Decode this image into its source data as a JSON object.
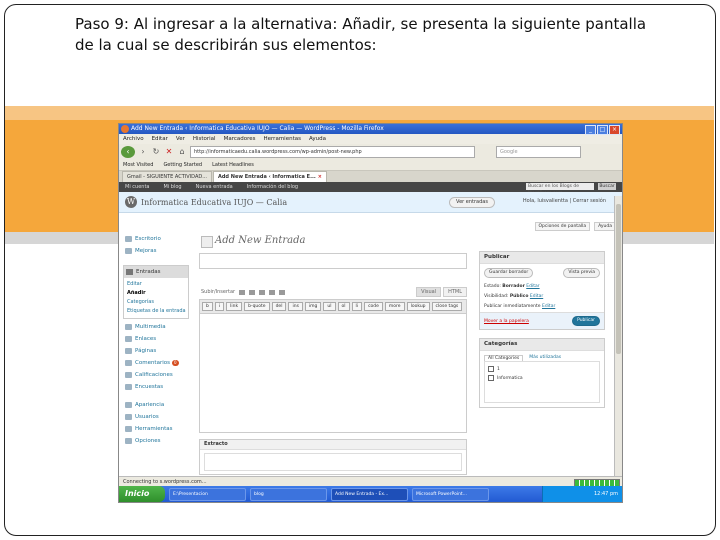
{
  "caption": {
    "line1": "Paso 9: Al ingresar a la alternativa: Añadir, se presenta la siguiente pantalla",
    "line2": "de la cual se describirán sus elementos:"
  },
  "browser": {
    "title": "Add New Entrada ‹ Informatica Educativa IUJO — Calia — WordPress - Mozilla Firefox",
    "menu": [
      "Archivo",
      "Editar",
      "Ver",
      "Historial",
      "Marcadores",
      "Herramientas",
      "Ayuda"
    ],
    "url": "http://informaticaedu.calia.wordpress.com/wp-admin/post-new.php",
    "search_placeholder": "Google",
    "bookmarks": [
      "Most Visited",
      "Getting Started",
      "Latest Headlines"
    ],
    "tabs": [
      {
        "label": "Gmail - SIGUIENTE ACTIVIDAD...",
        "active": false
      },
      {
        "label": "Add New Entrada ‹ Informatica E...",
        "active": true
      }
    ]
  },
  "wp_adminbar": {
    "items": [
      "Mi cuenta",
      "Mi blog",
      "Nueva entrada",
      "Información del blog"
    ],
    "search_placeholder": "Buscar en los Blogs de WordPress.com",
    "search_button": "Buscar"
  },
  "wp_header": {
    "blog_title": "Informatica Educativa IUJO — Calia",
    "new_post": "Ver entradas",
    "user_links": "Hola, luisvalientta | Cerrar sesión"
  },
  "screen_options": [
    "Opciones de pantalla",
    "Ayuda"
  ],
  "sidebar": {
    "top_items": [
      "Escritorio",
      "Mejoras"
    ],
    "open_menu": "Entradas",
    "submenu": [
      "Editar",
      "Añadir",
      "Categorías",
      "Etiquetas de la entrada"
    ],
    "submenu_current": "Añadir",
    "items": [
      "Multimedia",
      "Enlaces",
      "Páginas",
      "Comentarios",
      "Calificaciones",
      "Encuestas"
    ],
    "comments_badge": "0",
    "bottom_items": [
      "Apariencia",
      "Usuarios",
      "Herramientas",
      "Opciones"
    ]
  },
  "editor": {
    "page_title": "Add New Entrada",
    "upload_label": "Subir/Insertar",
    "tabs": [
      "Visual",
      "HTML"
    ],
    "quicktags": [
      "b",
      "i",
      "link",
      "b-quote",
      "del",
      "ins",
      "img",
      "ul",
      "ol",
      "li",
      "code",
      "more",
      "lookup",
      "close tags"
    ],
    "excerpt_label": "Extracto"
  },
  "publish_box": {
    "title": "Publicar",
    "save_draft": "Guardar borrador",
    "preview": "Vista previa",
    "status_label": "Estado:",
    "status_value": "Borrador",
    "status_edit": "Editar",
    "visibility_label": "Visibilidad:",
    "visibility_value": "Público",
    "visibility_edit": "Editar",
    "publish_time": "Publicar inmediatamente",
    "publish_time_edit": "Editar",
    "trash": "Mover a la papelera",
    "publish": "Publicar"
  },
  "categories_box": {
    "title": "Categorías",
    "tab_all": "All Categories",
    "tab_popular": "Más utilizadas",
    "items": [
      "1",
      "Informatica"
    ]
  },
  "status_bar": {
    "text": "Connecting to s.wordpress.com..."
  },
  "taskbar": {
    "start": "Inicio",
    "tasks": [
      "E:\\Presentacion",
      "blog",
      "Add New Entrada - Ex...",
      "Microsoft PowerPoint..."
    ],
    "active_task": 2,
    "clock": "12:47 pm"
  }
}
